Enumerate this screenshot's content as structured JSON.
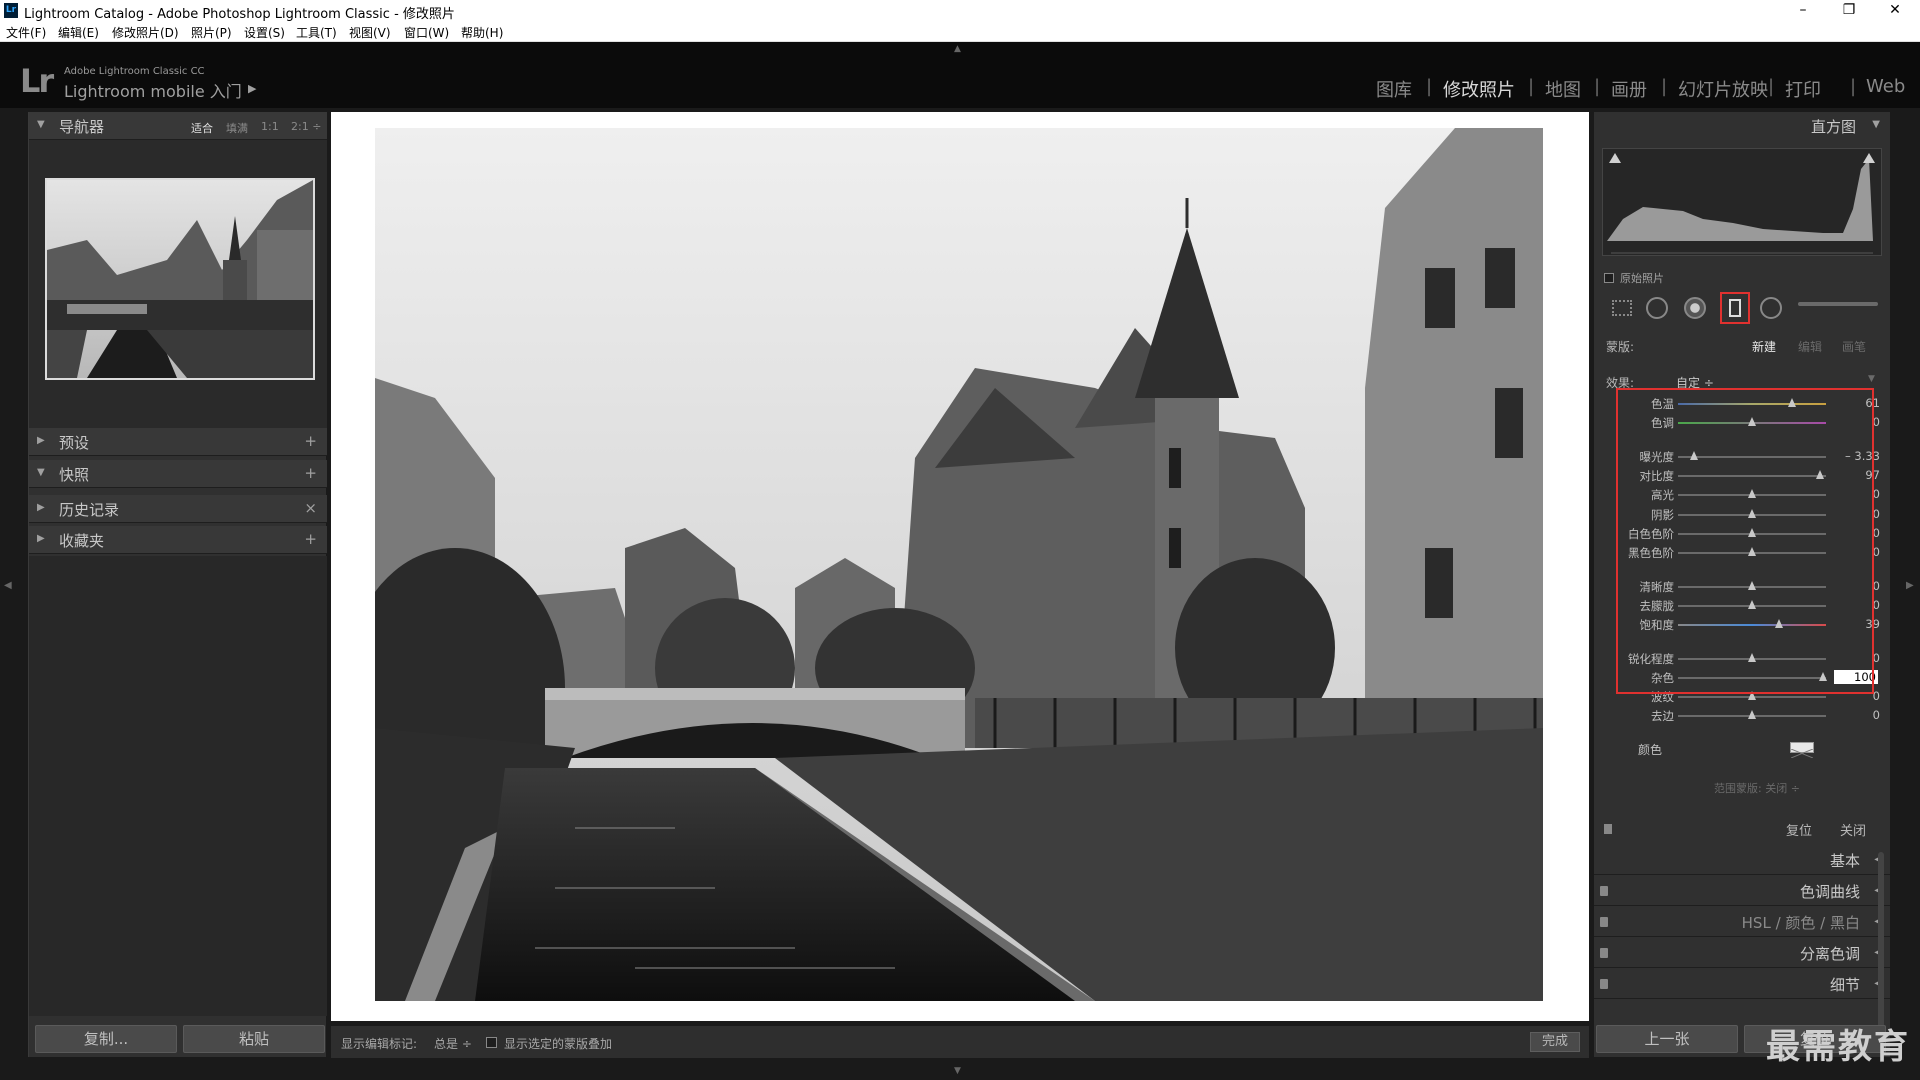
{
  "window": {
    "title": "Lightroom Catalog - Adobe Photoshop Lightroom Classic - 修改照片",
    "app_icon": "Lr",
    "controls": [
      "minimize-icon",
      "restore-icon",
      "close-icon"
    ]
  },
  "menu": [
    "文件(F)",
    "编辑(E)",
    "修改照片(D)",
    "照片(P)",
    "设置(S)",
    "工具(T)",
    "视图(V)",
    "窗口(W)",
    "帮助(H)"
  ],
  "identity": {
    "logo": "Lr",
    "small": "Adobe Lightroom Classic CC",
    "main": "Lightroom mobile 入门",
    "arrow": "▶"
  },
  "modules": [
    {
      "label": "图库",
      "active": false
    },
    {
      "label": "修改照片",
      "active": true
    },
    {
      "label": "地图",
      "active": false
    },
    {
      "label": "画册",
      "active": false
    },
    {
      "label": "幻灯片放映",
      "active": false
    },
    {
      "label": "打印",
      "active": false
    },
    {
      "label": "Web",
      "active": false
    }
  ],
  "module_separator": "|",
  "left_panel": {
    "navigator": {
      "title": "导航器",
      "options": [
        "适合",
        "填满",
        "1:1",
        "2:1 ÷"
      ],
      "selected": "适合"
    },
    "sections": [
      {
        "title": "预设",
        "action": "+"
      },
      {
        "title": "快照",
        "action": "+",
        "expanded": true
      },
      {
        "title": "历史记录",
        "action": "×"
      },
      {
        "title": "收藏夹",
        "action": "+"
      }
    ],
    "copy_button": "复制...",
    "paste_button": "粘贴"
  },
  "toolbar": {
    "show_marks_label": "显示编辑标记:",
    "show_marks_value": "总是 ÷",
    "overlay_label": "显示选定的蒙版叠加",
    "done_button": "完成"
  },
  "right_panel": {
    "histogram": {
      "title": "直方图",
      "original_photo": "原始照片"
    },
    "mask": {
      "label": "蒙版:",
      "new": "新建",
      "edit": "编辑",
      "brush": "画笔"
    },
    "effect": {
      "label": "效果:",
      "value": "自定 ÷"
    },
    "adjustments": [
      {
        "name": "色温",
        "value": "61",
        "pos": 0.77
      },
      {
        "name": "色调",
        "value": "0",
        "pos": 0.5
      },
      {
        "name": "曝光度",
        "value": "– 3.33",
        "pos": 0.11
      },
      {
        "name": "对比度",
        "value": "97",
        "pos": 0.96
      },
      {
        "name": "高光",
        "value": "0",
        "pos": 0.5
      },
      {
        "name": "阴影",
        "value": "0",
        "pos": 0.5
      },
      {
        "name": "白色色阶",
        "value": "0",
        "pos": 0.5
      },
      {
        "name": "黑色色阶",
        "value": "0",
        "pos": 0.5
      },
      {
        "name": "清晰度",
        "value": "0",
        "pos": 0.5
      },
      {
        "name": "去朦胧",
        "value": "0",
        "pos": 0.5
      },
      {
        "name": "饱和度",
        "value": "39",
        "pos": 0.68
      },
      {
        "name": "锐化程度",
        "value": "0",
        "pos": 0.5
      },
      {
        "name": "杂色",
        "value": "100",
        "pos": 0.98,
        "editing": true
      },
      {
        "name": "波纹",
        "value": "0",
        "pos": 0.5
      },
      {
        "name": "去边",
        "value": "0",
        "pos": 0.5
      }
    ],
    "color_label": "颜色",
    "range_mask": "范围蒙版: 关闭 ÷",
    "reset": "复位",
    "close": "关闭",
    "sections": [
      "基本",
      "色调曲线",
      "HSL / 颜色 / 黑白",
      "分离色调",
      "细节"
    ],
    "prev_button": "上一张",
    "reset_button": "复位"
  },
  "watermark": "最需教育"
}
